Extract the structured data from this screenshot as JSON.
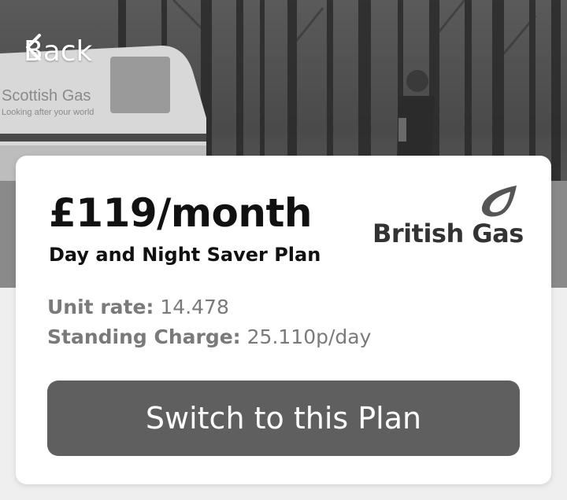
{
  "nav": {
    "back_label": "Back"
  },
  "hero": {
    "van_text_line1": "Scottish Gas",
    "van_text_line2": "Looking after your world"
  },
  "plan": {
    "price": "£119/month",
    "name": "Day and Night Saver Plan",
    "provider": "British Gas",
    "unit_rate_label": "Unit rate:",
    "unit_rate_value": "14.478",
    "standing_charge_label": "Standing Charge:",
    "standing_charge_value": "25.110p/day"
  },
  "actions": {
    "switch_label": "Switch to this Plan"
  },
  "colors": {
    "button_bg": "#5f5f5f",
    "card_bg": "#ffffff",
    "page_bg": "#efefef"
  },
  "icons": {
    "back": "chevron-left-icon",
    "logo": "flame-icon"
  }
}
